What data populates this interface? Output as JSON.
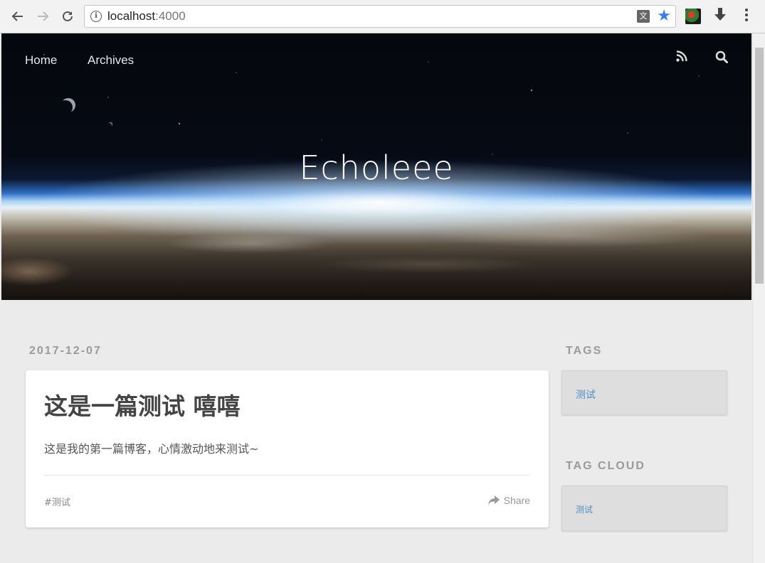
{
  "browser": {
    "url_host": "localhost",
    "url_port": ":4000"
  },
  "header": {
    "nav": [
      "Home",
      "Archives"
    ],
    "site_title": "Echoleee"
  },
  "post": {
    "date": "2017-12-07",
    "title": "这是一篇测试 嘻嘻",
    "excerpt": "这是我的第一篇博客，心情激动地来测试~",
    "tag": "#测试",
    "share_label": "Share"
  },
  "sidebar": {
    "tags_heading": "TAGS",
    "tags": [
      "测试"
    ],
    "tag_cloud_heading": "TAG CLOUD",
    "tag_cloud": [
      "测试"
    ]
  },
  "colors": {
    "link": "#4a90c8",
    "bookmark_star": "#3b7de8",
    "page_bg": "#ebebeb"
  }
}
